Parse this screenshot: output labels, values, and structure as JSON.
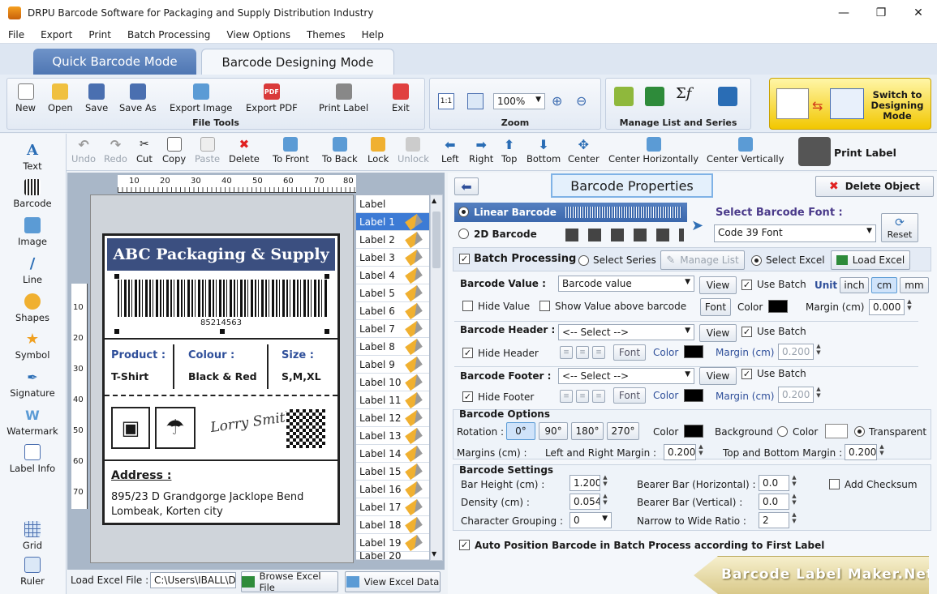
{
  "title": "DRPU Barcode Software for Packaging and Supply Distribution Industry",
  "menu": [
    "File",
    "Export",
    "Print",
    "Batch Processing",
    "View Options",
    "Themes",
    "Help"
  ],
  "modes": {
    "quick": "Quick Barcode Mode",
    "designing": "Barcode Designing Mode"
  },
  "file_tools": {
    "title": "File Tools",
    "buttons": [
      "New",
      "Open",
      "Save",
      "Save As",
      "Export Image",
      "Export PDF",
      "Print Label",
      "Exit"
    ]
  },
  "zoom": {
    "title": "Zoom",
    "value": "100%",
    "oneone": "1:1"
  },
  "manage": {
    "title": "Manage List and Series"
  },
  "switch_mode": "Switch to Designing Mode",
  "edit_tools": [
    "Undo",
    "Redo",
    "Cut",
    "Copy",
    "Paste",
    "Delete",
    "To Front",
    "To Back",
    "Lock",
    "Unlock",
    "Left",
    "Right",
    "Top",
    "Bottom",
    "Center",
    "Center Horizontally",
    "Center Vertically"
  ],
  "print_label": "Print Label",
  "left_tools": [
    "Text",
    "Barcode",
    "Image",
    "Line",
    "Shapes",
    "Symbol",
    "Signature",
    "Watermark",
    "Label Info",
    "Grid",
    "Ruler"
  ],
  "ruler_top": [
    "10",
    "20",
    "30",
    "40",
    "50",
    "60",
    "70",
    "80"
  ],
  "ruler_left": [
    "10",
    "20",
    "30",
    "40",
    "50",
    "60",
    "70"
  ],
  "label": {
    "company": "ABC Packaging & Supply",
    "barcode_number": "85214563",
    "product_label": "Product :",
    "product_value": "T-Shirt",
    "colour_label": "Colour :",
    "colour_value": "Black & Red",
    "size_label": "Size :",
    "size_value": "S,M,XL",
    "signature": "Lorry Smith",
    "address_label": "Address :",
    "address_value": "895/23 D Grandgorge Jacklope Bend Lombeak, Korten city"
  },
  "label_list": {
    "header": "Label",
    "items": [
      "Label 1",
      "Label 2",
      "Label 3",
      "Label 4",
      "Label 5",
      "Label 6",
      "Label 7",
      "Label 8",
      "Label 9",
      "Label 10",
      "Label 11",
      "Label 12",
      "Label 13",
      "Label 14",
      "Label 15",
      "Label 16",
      "Label 17",
      "Label 18",
      "Label 19",
      "Label 20"
    ]
  },
  "load_excel": {
    "label": "Load Excel File :",
    "path": "C:\\Users\\IBALL\\D",
    "browse": "Browse Excel File",
    "view": "View Excel Data"
  },
  "props": {
    "title": "Barcode Properties",
    "delete_object": "Delete Object",
    "linear": "Linear Barcode",
    "twod": "2D Barcode",
    "select_font_label": "Select Barcode Font :",
    "font_value": "Code 39 Font",
    "reset": "Reset",
    "batch_processing": "Batch Processing",
    "select_series": "Select Series",
    "manage_list": "Manage List",
    "select_excel": "Select Excel",
    "load_excel": "Load Excel",
    "barcode_value_label": "Barcode Value :",
    "barcode_value": "Barcode value",
    "view": "View",
    "use_batch": "Use Batch",
    "unit": "Unit",
    "units": [
      "inch",
      "cm",
      "mm"
    ],
    "hide_value": "Hide Value",
    "show_above": "Show Value above barcode",
    "font": "Font",
    "color": "Color",
    "margin_cm": "Margin (cm)",
    "margin_value": "0.000",
    "header_label": "Barcode Header :",
    "select_placeholder": "<-- Select -->",
    "hide_header": "Hide Header",
    "header_margin": "0.200",
    "footer_label": "Barcode Footer :",
    "hide_footer": "Hide Footer",
    "footer_margin": "0.200",
    "options_title": "Barcode Options",
    "rotation": "Rotation :",
    "rotations": [
      "0°",
      "90°",
      "180°",
      "270°"
    ],
    "background": "Background",
    "transparent": "Transparent",
    "margins_cm": "Margins (cm) :",
    "lr_margin": "Left and Right Margin :",
    "lr_value": "0.200",
    "tb_margin": "Top and Bottom Margin :",
    "tb_value": "0.200",
    "settings_title": "Barcode Settings",
    "bar_height": "Bar Height (cm) :",
    "bar_height_value": "1.200",
    "density": "Density (cm) :",
    "density_value": "0.054",
    "char_grouping": "Character Grouping :",
    "char_grouping_value": "0",
    "bearer_h": "Bearer Bar (Horizontal) :",
    "bearer_h_value": "0.0",
    "bearer_v": "Bearer Bar (Vertical) :",
    "bearer_v_value": "0.0",
    "narrow_wide": "Narrow to Wide Ratio :",
    "narrow_wide_value": "2",
    "add_checksum": "Add Checksum",
    "auto_position": "Auto Position Barcode in Batch Process according to First Label"
  },
  "watermark": "Barcode Label Maker.Net"
}
